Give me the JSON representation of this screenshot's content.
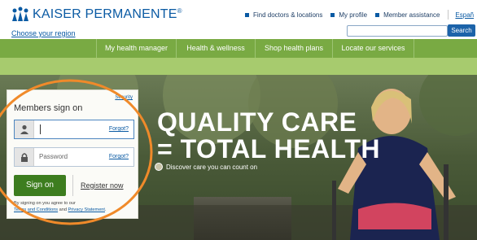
{
  "brand": {
    "name": "KAISER PERMANENTE",
    "mark": "®"
  },
  "utility": {
    "links": [
      "Find doctors & locations",
      "My profile",
      "Member assistance"
    ],
    "language": "Españ"
  },
  "region": {
    "label": "Choose your region"
  },
  "search": {
    "value": "",
    "placeholder": "",
    "button": "Search"
  },
  "nav": {
    "items": [
      "My health manager",
      "Health & wellness",
      "Shop health plans",
      "Locate our services"
    ]
  },
  "hero": {
    "title_line1": "QUALITY CARE",
    "title_line2": "= TOTAL HEALTH",
    "subtitle": "Discover care you can count on"
  },
  "signon": {
    "security_label": "Security",
    "title": "Members sign on",
    "user_value": "",
    "user_forgot": "Forgot?",
    "password_placeholder": "Password",
    "password_forgot": "Forgot?",
    "signon_button": "Sign on",
    "register_link": "Register now",
    "terms_prefix": "By signing on you agree to our",
    "terms_link": "Terms and Conditions",
    "terms_and": "and",
    "privacy_link": "Privacy Statement",
    "terms_end": "."
  },
  "colors": {
    "brand_blue": "#0a5aa3",
    "nav_green": "#79aa43",
    "nav_strip_green": "#a7cb6e",
    "signon_green": "#3d7d1f",
    "annotation_orange": "#f08a2a"
  },
  "icons": {
    "logo": "kp-figures-logo",
    "user": "person-icon",
    "password": "lock-icon",
    "subtitle_bullet": "circle-bullet-icon"
  }
}
